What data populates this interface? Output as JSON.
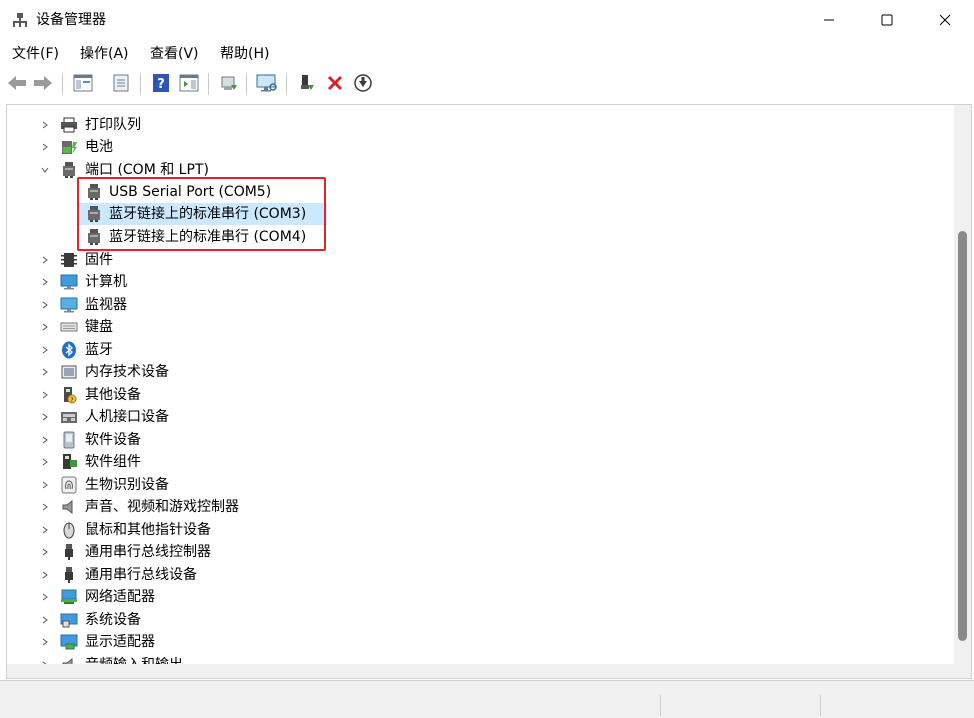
{
  "window": {
    "title": "设备管理器",
    "icon": "device-manager-icon"
  },
  "menu": [
    {
      "label": "文件(F)"
    },
    {
      "label": "操作(A)"
    },
    {
      "label": "查看(V)"
    },
    {
      "label": "帮助(H)"
    }
  ],
  "toolbar": [
    {
      "icon": "back-arrow-icon"
    },
    {
      "icon": "forward-arrow-icon"
    },
    {
      "icon": "show-hide-console-tree-icon"
    },
    {
      "icon": "properties-icon"
    },
    {
      "icon": "help-icon"
    },
    {
      "icon": "action-pane-icon"
    },
    {
      "icon": "update-driver-icon"
    },
    {
      "icon": "scan-hardware-icon"
    },
    {
      "icon": "enable-device-icon"
    },
    {
      "icon": "uninstall-device-icon"
    },
    {
      "icon": "download-driver-icon"
    }
  ],
  "tree": {
    "categories": [
      {
        "label": "打印队列",
        "icon": "printer-icon",
        "expanded": false
      },
      {
        "label": "电池",
        "icon": "battery-icon",
        "expanded": false
      },
      {
        "label": "端口 (COM 和 LPT)",
        "icon": "port-icon",
        "expanded": true
      },
      {
        "label": "固件",
        "icon": "firmware-icon",
        "expanded": false
      },
      {
        "label": "计算机",
        "icon": "computer-icon",
        "expanded": false
      },
      {
        "label": "监视器",
        "icon": "monitor-icon",
        "expanded": false
      },
      {
        "label": "键盘",
        "icon": "keyboard-icon",
        "expanded": false
      },
      {
        "label": "蓝牙",
        "icon": "bluetooth-icon",
        "expanded": false
      },
      {
        "label": "内存技术设备",
        "icon": "memory-device-icon",
        "expanded": false
      },
      {
        "label": "其他设备",
        "icon": "other-device-icon",
        "expanded": false
      },
      {
        "label": "人机接口设备",
        "icon": "hid-icon",
        "expanded": false
      },
      {
        "label": "软件设备",
        "icon": "software-device-icon",
        "expanded": false
      },
      {
        "label": "软件组件",
        "icon": "software-component-icon",
        "expanded": false
      },
      {
        "label": "生物识别设备",
        "icon": "fingerprint-icon",
        "expanded": false
      },
      {
        "label": "声音、视频和游戏控制器",
        "icon": "speaker-icon",
        "expanded": false
      },
      {
        "label": "鼠标和其他指针设备",
        "icon": "mouse-icon",
        "expanded": false
      },
      {
        "label": "通用串行总线控制器",
        "icon": "usb-icon",
        "expanded": false
      },
      {
        "label": "通用串行总线设备",
        "icon": "usb-icon",
        "expanded": false
      },
      {
        "label": "网络适配器",
        "icon": "network-adapter-icon",
        "expanded": false
      },
      {
        "label": "系统设备",
        "icon": "system-device-icon",
        "expanded": false
      },
      {
        "label": "显示适配器",
        "icon": "display-adapter-icon",
        "expanded": false
      },
      {
        "label": "音频输入和输出",
        "icon": "audio-io-icon",
        "expanded": false
      }
    ],
    "ports": [
      {
        "label": "USB Serial Port (COM5)",
        "icon": "port-icon",
        "selected": false
      },
      {
        "label": "蓝牙链接上的标准串行 (COM3)",
        "icon": "port-icon",
        "selected": true
      },
      {
        "label": "蓝牙链接上的标准串行 (COM4)",
        "icon": "port-icon",
        "selected": false
      }
    ]
  },
  "colors": {
    "highlight_border": "#e0262b",
    "selection": "#cce8ff"
  }
}
